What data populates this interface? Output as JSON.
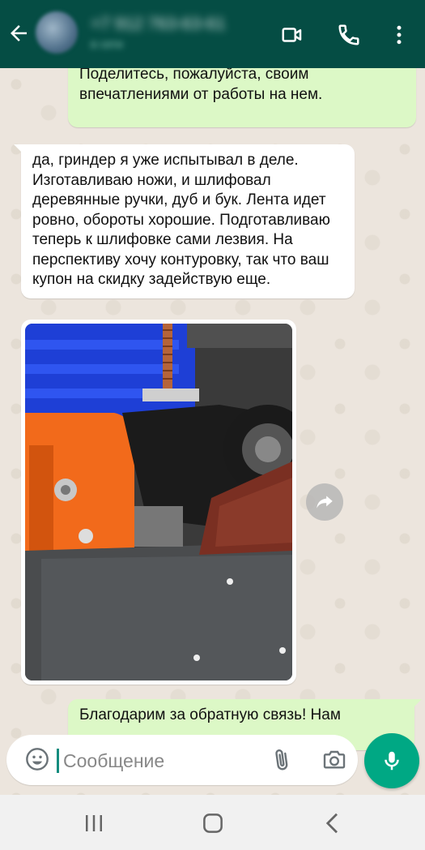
{
  "header": {
    "contact_name": "+7 912 763-63-61",
    "contact_status": "в сети"
  },
  "messages": [
    {
      "id": "m1",
      "direction": "outgoing",
      "text": "Поделитесь, пожалуйста, своим впечатлениями от работы на нем."
    },
    {
      "id": "m2",
      "direction": "incoming",
      "text": "да, гриндер я уже испытывал в деле. Изготавливаю ножи, и шлифовал деревянные ручки, дуб и бук. Лента идет ровно, обороты хорошие. Подготавливаю теперь к шлифовке сами лезвия. На перспективу хочу контуровку, так что ваш купон на скидку задействую еще."
    },
    {
      "id": "m3",
      "direction": "incoming",
      "type": "image",
      "alt": "belt grinder photo"
    },
    {
      "id": "m4",
      "direction": "outgoing",
      "text": "Благодарим за обратную связь! Нам"
    }
  ],
  "composer": {
    "placeholder": "Сообщение"
  },
  "icons": {
    "back": "arrow-left-icon",
    "video": "video-call-icon",
    "call": "phone-icon",
    "menu": "more-vert-icon",
    "emoji": "emoji-icon",
    "attach": "paperclip-icon",
    "camera": "camera-icon",
    "mic": "mic-icon",
    "forward": "forward-icon"
  },
  "colors": {
    "appbar": "#054d44",
    "outgoing_bubble": "#dcf8c6",
    "incoming_bubble": "#ffffff",
    "accent": "#00a884"
  }
}
